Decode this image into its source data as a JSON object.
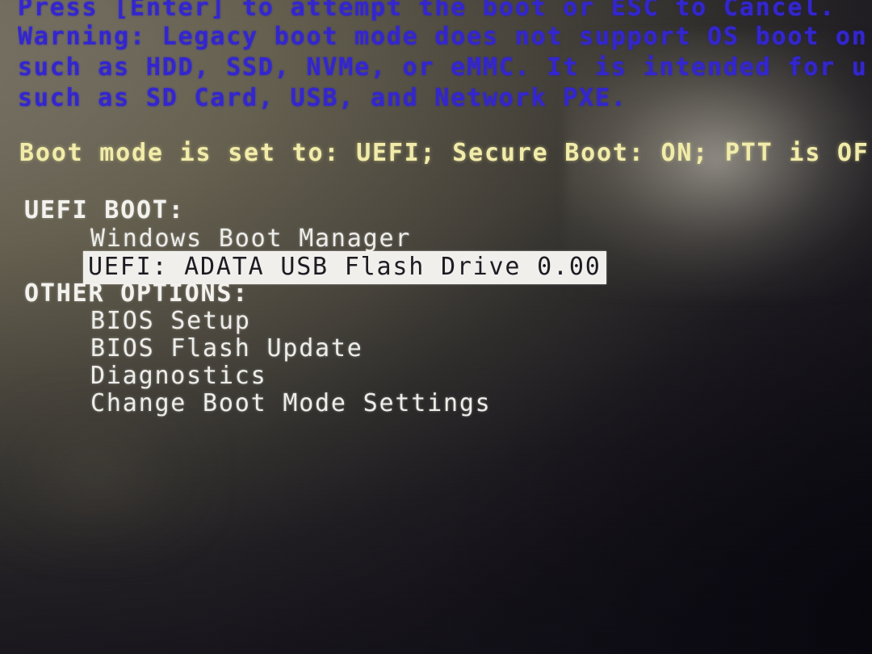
{
  "screen": {
    "kind": "firmware-boot-menu",
    "background_color": "#17151b",
    "warm_glow_color": "#6f6a5c",
    "glare_color": "#f5f0e1"
  },
  "warning": {
    "color": "#3326cf",
    "lines": [
      "Press [Enter] to attempt the boot or ESC to Cancel.",
      "Warning: Legacy boot mode does not support OS boot on",
      "such as HDD, SSD, NVMe, or eMMC. It is intended for u",
      "such as SD Card, USB, and Network PXE."
    ]
  },
  "status": {
    "color": "#f2ecaa",
    "line": "Boot mode is set to: UEFI; Secure Boot: ON; PTT is OF",
    "boot_mode": "UEFI",
    "secure_boot": "ON",
    "ptt": "OF"
  },
  "menu": {
    "text_color": "#f3f2ee",
    "selected_background": "#f0efec",
    "selected_text_color": "#1d1c22",
    "groups": [
      {
        "header": "UEFI BOOT:",
        "items": [
          {
            "label": "Windows Boot Manager",
            "selected": false
          },
          {
            "label": "UEFI: ADATA USB Flash Drive 0.00",
            "selected": true
          }
        ]
      },
      {
        "header": "OTHER OPTIONS:",
        "items": [
          {
            "label": "BIOS Setup",
            "selected": false
          },
          {
            "label": "BIOS Flash Update",
            "selected": false
          },
          {
            "label": "Diagnostics",
            "selected": false
          },
          {
            "label": "Change Boot Mode Settings",
            "selected": false
          }
        ]
      }
    ]
  }
}
